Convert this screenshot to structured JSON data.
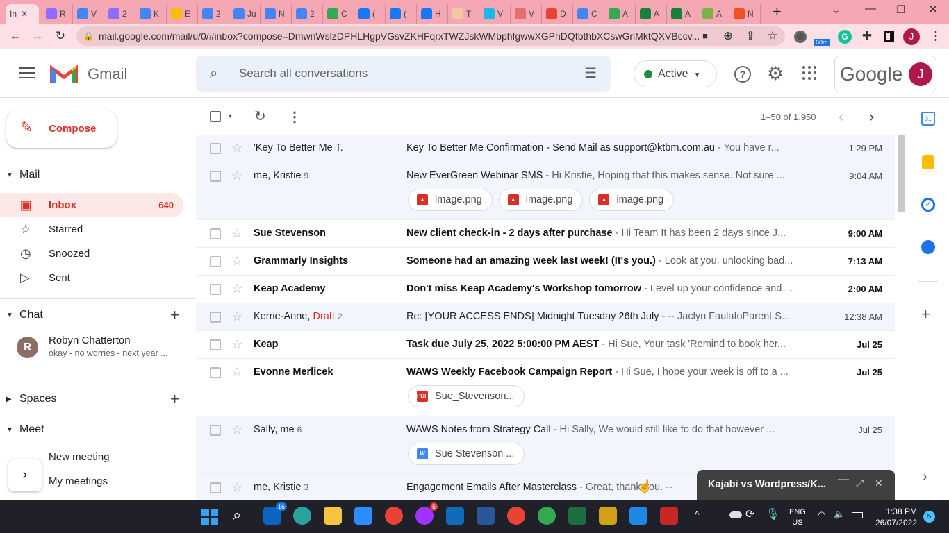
{
  "browser": {
    "tabs": [
      "In",
      "R",
      "V",
      "2",
      "K",
      "E",
      "2",
      "Ju",
      "N",
      "2",
      "C",
      "(",
      "(",
      "H",
      "T",
      "V",
      "V",
      "D",
      "C",
      "A",
      "A",
      "A",
      "A",
      "N"
    ],
    "tab_colors": [
      "#ea4335",
      "#8e6cff",
      "#4285f4",
      "#8e6cff",
      "#4285f4",
      "#fbbc04",
      "#4285f4",
      "#4285f4",
      "#4285f4",
      "#4285f4",
      "#34a853",
      "#1877f2",
      "#1877f2",
      "#1877f2",
      "#f4c7a0",
      "#1ab7ea",
      "#e56f6f",
      "#ea4335",
      "#4285f4",
      "#34a853",
      "#188038",
      "#188038",
      "#7cb342",
      "#f25022"
    ],
    "url": "mail.google.com/mail/u/0/#inbox?compose=DmwnWslzDPHLHgpVGsvZKHFqrxTWZJskWMbphfgwwXGPhDQfbthbXCswGnMktQXVBccv...",
    "extension_badge": "60m",
    "profile_initial": "J"
  },
  "gmail": {
    "logo_text": "Gmail",
    "search_placeholder": "Search all conversations",
    "status": "Active",
    "google_text": "Google",
    "avatar_initial": "J",
    "compose": "Compose",
    "mail_section": "Mail",
    "nav": [
      {
        "label": "Inbox",
        "count": "640",
        "icon": "inbox-icon"
      },
      {
        "label": "Starred",
        "icon": "star-icon"
      },
      {
        "label": "Snoozed",
        "icon": "clock-icon"
      },
      {
        "label": "Sent",
        "icon": "send-icon"
      }
    ],
    "chat_section": "Chat",
    "chat_contact": {
      "initial": "R",
      "name": "Robyn Chatterton",
      "preview": "okay - no worries - next year ..."
    },
    "spaces_section": "Spaces",
    "meet_section": "Meet",
    "meet_items": [
      "New meeting",
      "My meetings"
    ],
    "pagination": "1–50 of 1,950",
    "emails": [
      {
        "from": "'Key To Better Me T.",
        "subject": "Key To Better Me Confirmation - Send Mail as support@ktbm.com.au",
        "snippet": " - You have r...",
        "time": "1:29 PM",
        "read": true
      },
      {
        "from": "me, Kristie",
        "count": "9",
        "subject": "New EverGreen Webinar SMS",
        "snippet": " - Hi Kristie, Hoping that this makes sense. Not sure ...",
        "time": "9:04 AM",
        "read": true,
        "attachments": [
          {
            "name": "image.png",
            "type": "img"
          },
          {
            "name": "image.png",
            "type": "img"
          },
          {
            "name": "image.png",
            "type": "img"
          }
        ]
      },
      {
        "from": "Sue Stevenson",
        "subject": "New client check-in - 2 days after purchase",
        "snippet": " - Hi Team It has been 2 days since J...",
        "time": "9:00 AM",
        "read": false
      },
      {
        "from": "Grammarly Insights",
        "subject": "Someone had an amazing week last week! (It's you.)",
        "snippet": " - Look at you, unlocking bad...",
        "time": "7:13 AM",
        "read": false
      },
      {
        "from": "Keap Academy",
        "subject": "Don't miss Keap Academy's Workshop tomorrow",
        "snippet": " - Level up your confidence and ...",
        "time": "2:00 AM",
        "read": false
      },
      {
        "from": "Kerrie-Anne,",
        "draft": "Draft",
        "count": "2",
        "subject": "Re: [YOUR ACCESS ENDS] Midnight Tuesday 26th July",
        "snippet": " - -- Jaclyn FaulafoParent S...",
        "time": "12:38 AM",
        "read": true
      },
      {
        "from": "Keap",
        "subject": "Task due July 25, 2022 5:00:00 PM AEST",
        "snippet": " - Hi Sue, Your task 'Remind to book her...",
        "time": "Jul 25",
        "read": false
      },
      {
        "from": "Evonne Merlicek",
        "subject": "WAWS Weekly Facebook Campaign Report",
        "snippet": " - Hi Sue, I hope your week is off to a ...",
        "time": "Jul 25",
        "read": false,
        "attachments": [
          {
            "name": "Sue_Stevenson...",
            "type": "pdf"
          }
        ]
      },
      {
        "from": "Sally, me",
        "count": "6",
        "subject": "WAWS Notes from Strategy Call",
        "snippet": " - Hi Sally, We would still like to do that however ...",
        "time": "Jul 25",
        "read": true,
        "attachments": [
          {
            "name": "Sue Stevenson ...",
            "type": "doc"
          }
        ]
      },
      {
        "from": "me, Kristie",
        "count": "3",
        "subject": "Engagement Emails After Masterclass",
        "snippet": " - Great, thank you. --",
        "time": "",
        "read": true
      }
    ],
    "compose_window_title": "Kajabi vs Wordpress/K..."
  },
  "taskbar": {
    "mail_badge": "16",
    "messenger_badge": "5",
    "lang1": "ENG",
    "lang2": "US",
    "time": "1:38 PM",
    "date": "26/07/2022",
    "notifications": "5"
  }
}
